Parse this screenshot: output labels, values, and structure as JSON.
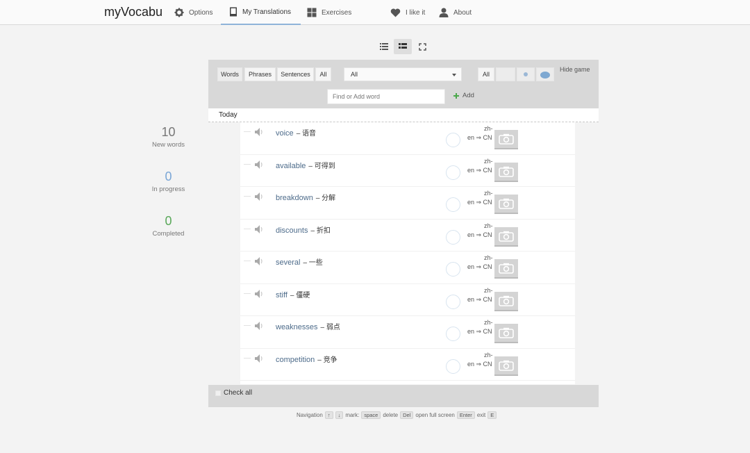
{
  "nav": {
    "brand": "myVocabu",
    "options": "Options",
    "my_translations": "My Translations",
    "exercises": "Exercises",
    "i_like_it": "I like it",
    "about": "About"
  },
  "filters": {
    "types": [
      "Words",
      "Phrases",
      "Sentences",
      "All"
    ],
    "selected_type": "Words",
    "dropdown_value": "All",
    "state_all": "All",
    "hide_game": "Hide game",
    "search_placeholder": "Find or Add word",
    "add_label": "Add"
  },
  "group_label": "Today",
  "stats": {
    "new_words": {
      "value": "10",
      "label": "New words",
      "color": "#777777"
    },
    "in_progress": {
      "value": "0",
      "label": "In progress",
      "color": "#7aa6d6"
    },
    "completed": {
      "value": "0",
      "label": "Completed",
      "color": "#5aa85a"
    }
  },
  "rows": [
    {
      "word": "voice",
      "translation": "– 语音",
      "lang_top": "zh-",
      "lang_bottom": "en ⇒ CN"
    },
    {
      "word": "available",
      "translation": "– 可得到",
      "lang_top": "zh-",
      "lang_bottom": "en ⇒ CN"
    },
    {
      "word": "breakdown",
      "translation": "– 分解",
      "lang_top": "zh-",
      "lang_bottom": "en ⇒ CN"
    },
    {
      "word": "discounts",
      "translation": "– 折扣",
      "lang_top": "zh-",
      "lang_bottom": "en ⇒ CN"
    },
    {
      "word": "several",
      "translation": "– 一些",
      "lang_top": "zh-",
      "lang_bottom": "en ⇒ CN"
    },
    {
      "word": "stiff",
      "translation": "– 僵硬",
      "lang_top": "zh-",
      "lang_bottom": "en ⇒ CN"
    },
    {
      "word": "weaknesses",
      "translation": "– 弱点",
      "lang_top": "zh-",
      "lang_bottom": "en ⇒ CN"
    },
    {
      "word": "competition",
      "translation": "– 竞争",
      "lang_top": "zh-",
      "lang_bottom": "en ⇒ CN"
    }
  ],
  "footer": {
    "check_all": "Check all",
    "hints": {
      "navigation": "Navigation",
      "mark": "mark:",
      "space": "space",
      "delete": "delete",
      "del": "Del",
      "open_full_screen": "open full screen",
      "enter": "Enter",
      "exit": "exit",
      "exit_key": "E"
    }
  }
}
